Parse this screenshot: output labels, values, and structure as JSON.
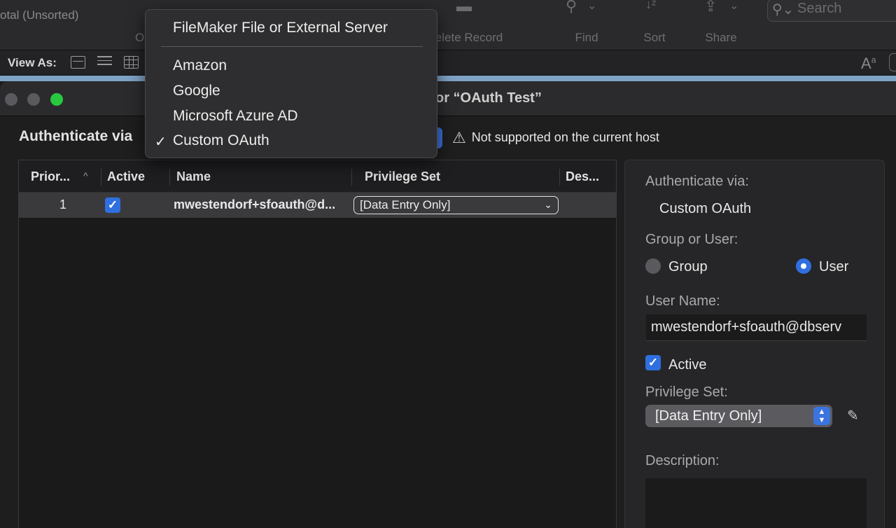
{
  "toolbar": {
    "total": "otal (Unsorted)",
    "o_label": "O",
    "delete_record": "elete Record",
    "find": "Find",
    "sort": "Sort",
    "share": "Share",
    "search_placeholder": "Search"
  },
  "viewbar": {
    "label": "View As:"
  },
  "dialog": {
    "title": "ty for “OAuth Test”",
    "authenticate_via_label": "Authenticate via",
    "warning": "Not supported on the current host"
  },
  "table": {
    "columns": [
      "Prior...",
      "Active",
      "Name",
      "Privilege Set",
      "Des..."
    ],
    "rows": [
      {
        "priority": "1",
        "active": true,
        "name": "mwestendorf+sfoauth@d...",
        "privilege_set": "[Data Entry Only]"
      }
    ]
  },
  "panel": {
    "authenticate_via_label": "Authenticate via:",
    "authenticate_via_value": "Custom OAuth",
    "group_or_user_label": "Group or User:",
    "group_option": "Group",
    "user_option": "User",
    "selected": "User",
    "user_name_label": "User Name:",
    "user_name_value": "mwestendorf+sfoauth@dbserv",
    "active_label": "Active",
    "active_checked": true,
    "privilege_set_label": "Privilege Set:",
    "privilege_set_value": "[Data Entry Only]",
    "description_label": "Description:"
  },
  "menu": {
    "items": [
      "FileMaker File or External Server",
      "Amazon",
      "Google",
      "Microsoft Azure AD",
      "Custom OAuth"
    ],
    "checked_item": "Custom OAuth",
    "checkmark": "✓"
  },
  "colors": {
    "accent": "#2f6fe0",
    "close_light": "#5a5a5e",
    "zoom_light": "#28c840"
  }
}
